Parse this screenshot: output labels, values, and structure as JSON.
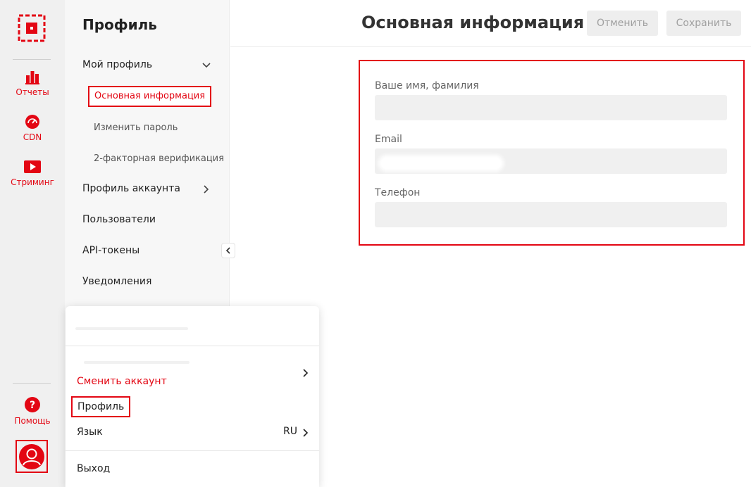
{
  "rail": {
    "items": [
      {
        "label": "Отчеты",
        "icon": "bar-chart-icon"
      },
      {
        "label": "CDN",
        "icon": "speedometer-icon"
      },
      {
        "label": "Стриминг",
        "icon": "play-icon"
      }
    ],
    "help_label": "Помощь"
  },
  "sidebar": {
    "title": "Профиль",
    "my_profile": "Мой профиль",
    "sub_items": [
      "Основная информация",
      "Изменить пароль",
      "2-факторная верификация"
    ],
    "account_profile": "Профиль аккаунта",
    "users": "Пользователи",
    "api_tokens": "API-токены",
    "notifications": "Уведомления"
  },
  "header": {
    "title": "Основная информация",
    "cancel_label": "Отменить",
    "save_label": "Сохранить"
  },
  "form": {
    "name_label": "Ваше имя, фамилия",
    "name_value": "",
    "email_label": "Email",
    "email_value": "",
    "phone_label": "Телефон",
    "phone_value": ""
  },
  "popup": {
    "switch_account": "Сменить аккаунт",
    "profile": "Профиль",
    "language": "Язык",
    "language_value": "RU",
    "logout": "Выход"
  },
  "colors": {
    "accent": "#e30613",
    "rail_bg": "#f0f0f0",
    "sidebar_bg": "#f7f7f7",
    "field_bg": "#f0f0f0"
  }
}
